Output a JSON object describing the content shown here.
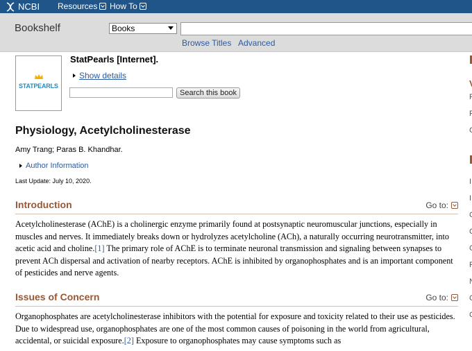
{
  "ncbi": {
    "logo_text": "NCBI",
    "menu": [
      {
        "label": "Resources"
      },
      {
        "label": "How To"
      }
    ]
  },
  "search": {
    "db_label": "Bookshelf",
    "db_selected": "Books",
    "term_value": "",
    "links": [
      {
        "label": "Browse Titles"
      },
      {
        "label": "Advanced"
      }
    ]
  },
  "book": {
    "cover_logo": "STATPEARLS",
    "title": "StatPearls [Internet].",
    "show_details": "Show details",
    "search_value": "",
    "search_button": "Search this book"
  },
  "article": {
    "title": "Physiology, Acetylcholinesterase",
    "authors": "Amy Trang; Paras B. Khandhar.",
    "author_info": "Author Information",
    "last_update": "Last Update: July 10, 2020."
  },
  "sections": [
    {
      "heading": "Introduction",
      "goto": "Go to:",
      "text_before": "Acetylcholinesterase (AChE) is a cholinergic enzyme primarily found at postsynaptic neuromuscular junctions, especially in muscles and nerves. It immediately breaks down or hydrolyzes acetylcholine (ACh), a naturally occurring neurotransmitter, into acetic acid and choline.",
      "ref": "[1]",
      "text_after": " The primary role of AChE is to terminate neuronal transmission and signaling between synapses to prevent ACh dispersal and activation of nearby receptors. AChE is inhibited by organophosphates and is an important component of pesticides and nerve agents."
    },
    {
      "heading": "Issues of Concern",
      "goto": "Go to:",
      "text_before": "Organophosphates are acetylcholinesterase inhibitors with the potential for exposure and toxicity related to their use as pesticides. Due to widespread use, organophosphates are one of the most common causes of poisoning in the world from agricultural, accidental, or suicidal exposure.",
      "ref": "[2]",
      "text_after": " Exposure to organophosphates may cause symptoms such as"
    }
  ],
  "sidebar_fragments": [
    "V",
    "F",
    "F",
    "C",
    "I",
    "I",
    "C",
    "C",
    "C",
    "F",
    "N",
    "C",
    "C"
  ],
  "colors": {
    "ncbi_blue": "#20558a",
    "link": "#2b5aa0",
    "section_heading": "#985735"
  }
}
